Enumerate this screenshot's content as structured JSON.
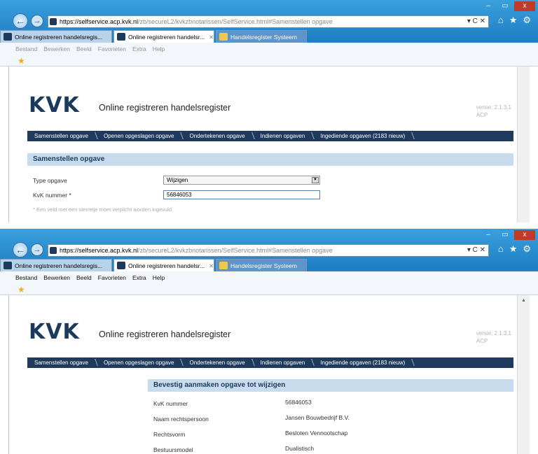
{
  "browser": {
    "url_host": "https://selfservice.acp.kvk.nl",
    "url_path": "/zb/secureL2/kvkzbnotarissen/SelfService.html#Samenstellen opgave",
    "address_actions": "▾ C ✕",
    "tabs": [
      {
        "label": "Online registreren handelsregis..."
      },
      {
        "label": "Online registreren handelsr...",
        "close": "✕"
      },
      {
        "label": "Handelsregister Systeem"
      }
    ],
    "menu": [
      "Bestand",
      "Bewerken",
      "Beeld",
      "Favorieten",
      "Extra",
      "Help"
    ],
    "window_controls": [
      "–",
      "▭",
      "x"
    ],
    "toolbar_icons": [
      "home-icon",
      "star-icon",
      "gear-icon"
    ]
  },
  "app": {
    "logo": "KVK",
    "title": "Online registreren handelsregister",
    "version_line1": "versie: 2.1.3.1",
    "version_line2": "ACP",
    "steps": [
      "Samenstellen opgave",
      "Openen opgeslagen opgave",
      "Ondertekenen opgave",
      "Indienen opgaven",
      "Ingediende opgaven (2183 nieuw)"
    ]
  },
  "screen1": {
    "section_title": "Samenstellen opgave",
    "type_label": "Type opgave",
    "type_value": "Wijzigen",
    "kvk_label": "KvK nummer *",
    "kvk_value": "56846053",
    "hint": "* Een veld met een sterretje moet verplicht worden ingevuld."
  },
  "screen2": {
    "section_title": "Bevestig aanmaken opgave tot wijzigen",
    "rows": [
      {
        "label": "KvK nummer",
        "value": "56846053"
      },
      {
        "label": "Naam rechtspersoon",
        "value": "Jansen Bouwbedrijf B.V."
      },
      {
        "label": "Rechtsvorm",
        "value": "Besloten Vennootschap"
      },
      {
        "label": "Bestuursmodel",
        "value": "Dualistisch"
      }
    ]
  }
}
